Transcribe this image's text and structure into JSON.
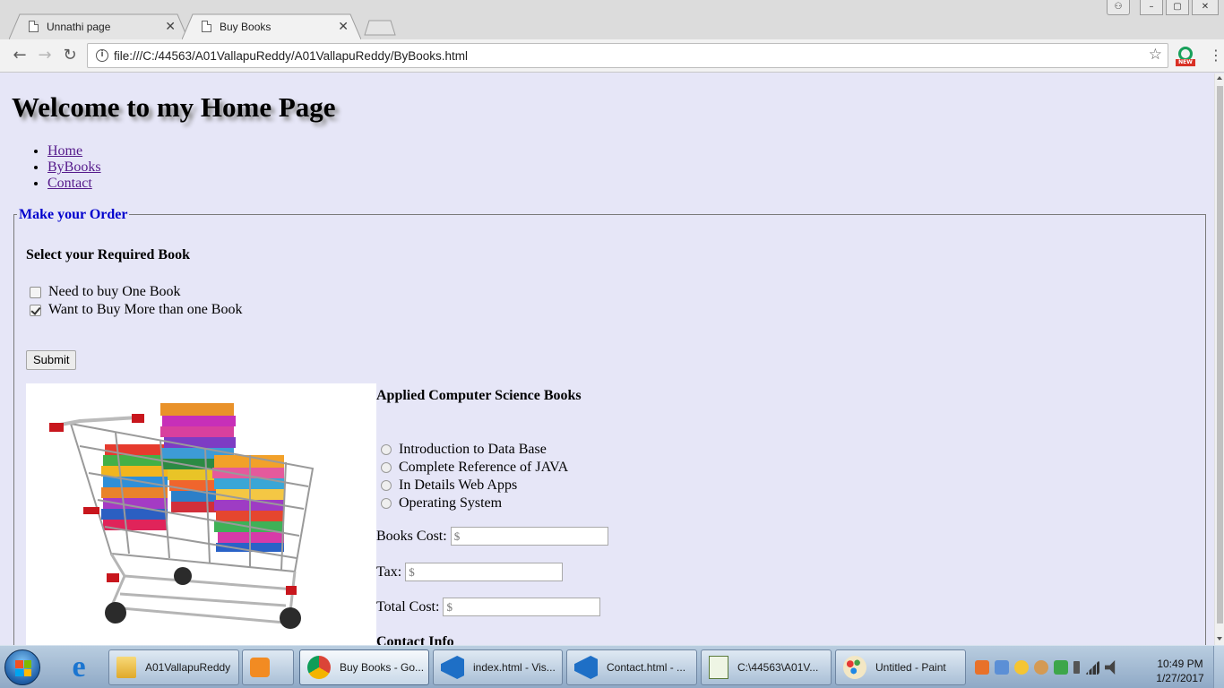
{
  "browser": {
    "tabs": [
      {
        "title": "Unnathi page"
      },
      {
        "title": "Buy Books"
      }
    ],
    "url": "file:///C:/44563/A01VallapuReddy/A01VallapuReddy/ByBooks.html",
    "extension_badge": "NEW"
  },
  "page": {
    "heading": "Welcome to my Home Page",
    "nav": [
      "Home",
      "ByBooks",
      "Contact"
    ],
    "order": {
      "legend": "Make your Order",
      "select_heading": "Select your Required Book",
      "options": [
        {
          "label": "Need to buy One Book",
          "checked": false
        },
        {
          "label": "Want to Buy More than one Book",
          "checked": true
        }
      ],
      "submit_label": "Submit"
    },
    "books": {
      "heading": "Applied Computer Science Books",
      "titles": [
        "Introduction to Data Base",
        "Complete Reference of JAVA",
        "In Details Web Apps",
        "Operating System"
      ],
      "fields": [
        {
          "label": "Books Cost:",
          "placeholder": "$"
        },
        {
          "label": "Tax:",
          "placeholder": "$"
        },
        {
          "label": "Total Cost:",
          "placeholder": "$"
        }
      ],
      "contact_heading": "Contact Info"
    }
  },
  "taskbar": {
    "buttons": [
      {
        "label": "A01VallapuReddy",
        "icon": "folder-icon"
      },
      {
        "label": "",
        "icon": "media-player-icon"
      },
      {
        "label": "Buy Books - Go...",
        "icon": "chrome-icon"
      },
      {
        "label": "index.html - Vis...",
        "icon": "visual-studio-icon"
      },
      {
        "label": "Contact.html - ...",
        "icon": "visual-studio-icon"
      },
      {
        "label": "C:\\44563\\A01V...",
        "icon": "notepad-icon"
      },
      {
        "label": "Untitled - Paint",
        "icon": "paint-icon"
      }
    ],
    "clock_time": "10:49 PM",
    "clock_date": "1/27/2017"
  },
  "colors": {
    "page_background": "#e6e6f7",
    "legend_text": "#0000cd",
    "visited_link": "#551a8b"
  }
}
